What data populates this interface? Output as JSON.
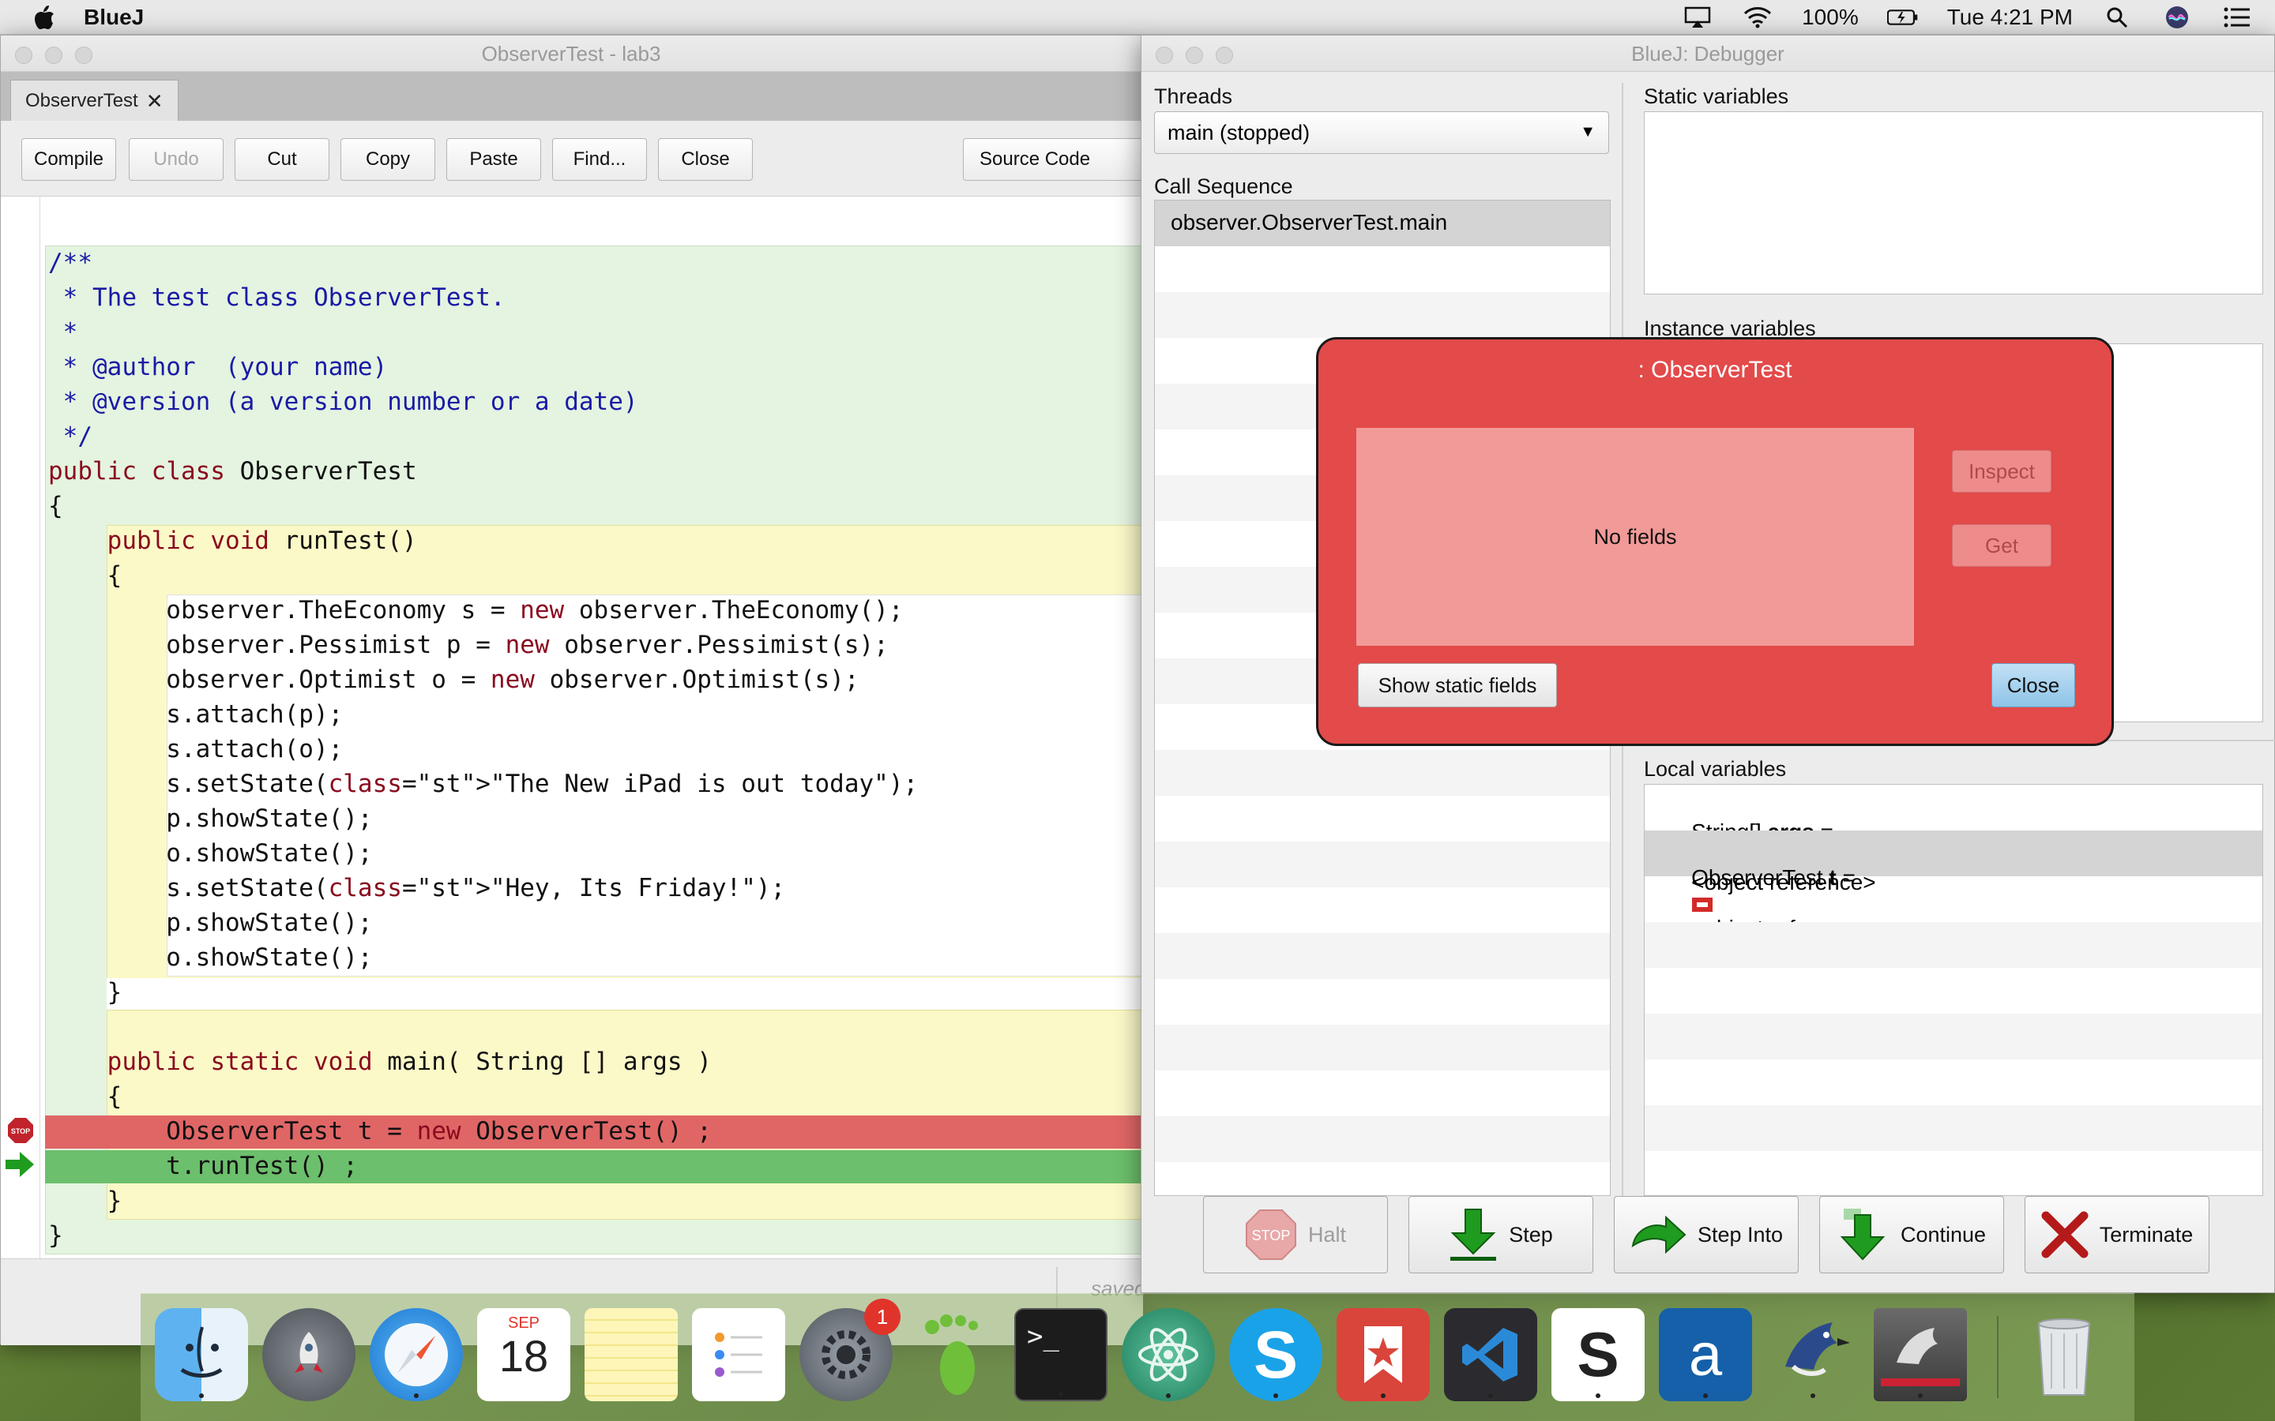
{
  "menubar": {
    "app_name": "BlueJ",
    "battery": "100%",
    "clock": "Tue 4:21 PM"
  },
  "editor": {
    "title": "ObserverTest - lab3",
    "tab_label": "ObserverTest",
    "toolbar": {
      "compile": "Compile",
      "undo": "Undo",
      "cut": "Cut",
      "copy": "Copy",
      "paste": "Paste",
      "find": "Find...",
      "close": "Close",
      "view_mode": "Source Code"
    },
    "status": "saved",
    "code_lines": [
      "/**",
      " * The test class ObserverTest.",
      " *",
      " * @author  (your name)",
      " * @version (a version number or a date)",
      " */",
      "public class ObserverTest",
      "{",
      "    public void runTest()",
      "    {",
      "        observer.TheEconomy s = new observer.TheEconomy();",
      "        observer.Pessimist p = new observer.Pessimist(s);",
      "        observer.Optimist o = new observer.Optimist(s);",
      "        s.attach(p);",
      "        s.attach(o);",
      "        s.setState(\"The New iPad is out today\");",
      "        p.showState();",
      "        o.showState();",
      "        s.setState(\"Hey, Its Friday!\");",
      "        p.showState();",
      "        o.showState();",
      "    }",
      "",
      "    public static void main( String [] args )",
      "    {",
      "        ObserverTest t = new ObserverTest() ;",
      "        t.runTest() ;",
      "    }",
      "}"
    ]
  },
  "debugger": {
    "title": "BlueJ:  Debugger",
    "threads_label": "Threads",
    "thread_selected": "main (stopped)",
    "call_sequence_label": "Call Sequence",
    "call_sequence": [
      "observer.ObserverTest.main"
    ],
    "static_vars_label": "Static variables",
    "instance_vars_label": "Instance variables",
    "local_vars_label": "Local variables",
    "locals": [
      {
        "type": "String[]",
        "name": "args",
        "eq": "=",
        "value": "<object reference>"
      },
      {
        "type": "ObserverTest",
        "name": "t",
        "eq": "=",
        "value": "<object reference>"
      }
    ],
    "buttons": {
      "halt": "Halt",
      "step": "Step",
      "step_into": "Step Into",
      "continue": "Continue",
      "terminate": "Terminate"
    }
  },
  "inspector": {
    "title": ": ObserverTest",
    "no_fields": "No fields",
    "inspect": "Inspect",
    "get": "Get",
    "show_static": "Show static fields",
    "close": "Close"
  },
  "dock": {
    "calendar_month": "SEP",
    "calendar_day": "18",
    "prefs_badge": "1"
  },
  "colors": {
    "breakpoint_line": "#e06666",
    "current_line": "#6cbf6c",
    "inspector_bg": "#e34a4a",
    "class_block": "#e4f4e0",
    "method_block": "#fbf9c8"
  }
}
